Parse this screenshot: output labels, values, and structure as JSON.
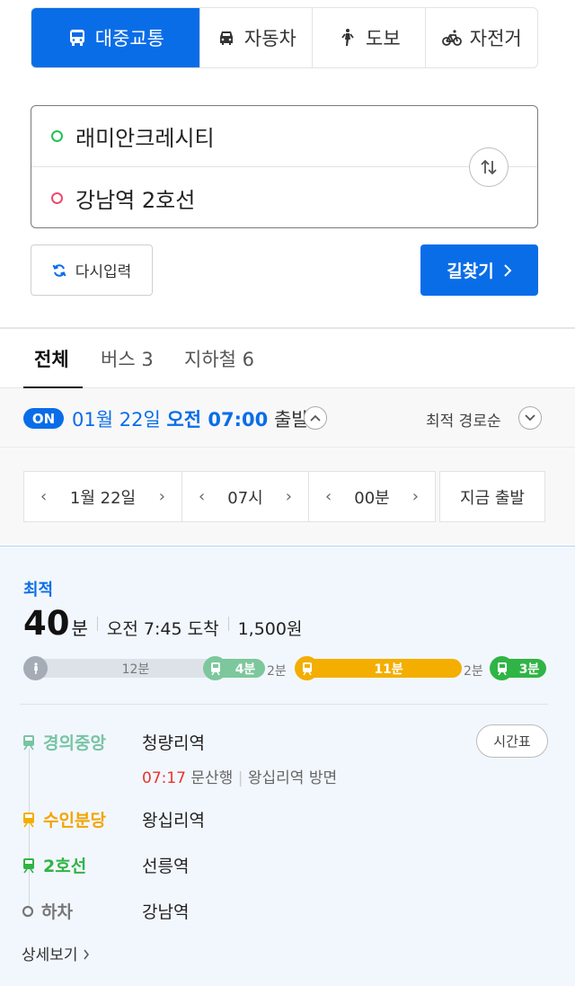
{
  "modes": [
    {
      "label": "대중교통",
      "icon": "bus-icon",
      "active": true
    },
    {
      "label": "자동차",
      "icon": "car-icon",
      "active": false
    },
    {
      "label": "도보",
      "icon": "walk-icon",
      "active": false
    },
    {
      "label": "자전거",
      "icon": "bicycle-icon",
      "active": false
    }
  ],
  "search": {
    "origin": "래미안크레시티",
    "destination": "강남역 2호선"
  },
  "buttons": {
    "reset": "다시입력",
    "find": "길찾기"
  },
  "result_tabs": {
    "all": "전체",
    "bus": "버스 3",
    "subway": "지하철 6"
  },
  "departure": {
    "on_badge": "ON",
    "date": "01월 22일",
    "time": "오전 07:00",
    "suffix": "출발",
    "sort": "최적 경로순"
  },
  "time_selectors": {
    "date": "1월 22일",
    "hour": "07시",
    "minute": "00분",
    "now": "지금 출발"
  },
  "route": {
    "badge": "최적",
    "duration": "40",
    "duration_unit": "분",
    "arrival": "오전 7:45 도착",
    "fare": "1,500원",
    "timeline": {
      "walk": "12분",
      "leg1": "4분",
      "gap1": "2분",
      "leg2": "11분",
      "gap2": "2분",
      "leg3": "3분"
    },
    "steps": [
      {
        "line": "경의중앙",
        "station": "청량리역",
        "color": "#77c4a3"
      },
      {
        "line": "수인분당",
        "station": "왕십리역",
        "color": "#f5a200"
      },
      {
        "line": "2호선",
        "station": "선릉역",
        "color": "#33a23d"
      },
      {
        "line": "하차",
        "station": "강남역",
        "color": "#777777"
      }
    ],
    "detail": {
      "time": "07:17",
      "direction": "문산행",
      "platform": "왕십리역 방면"
    },
    "timetable": "시간표",
    "more": "상세보기"
  },
  "colors": {
    "primary": "#0a6de8",
    "gyeongui": "#77c4a3",
    "suin": "#f3ae00",
    "line2": "#30b445"
  }
}
